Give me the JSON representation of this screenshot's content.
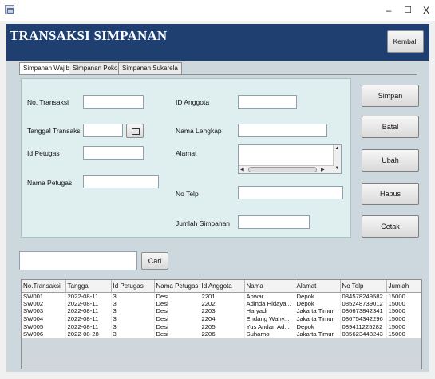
{
  "window": {
    "app_icon": "java-cup-icon",
    "minimize_glyph": "–",
    "maximize_glyph": "☐",
    "close_glyph": "X"
  },
  "header": {
    "title": "TRANSAKSI SIMPANAN",
    "back_label": "Kembali",
    "background_color": "#1f3f71"
  },
  "tabs": [
    {
      "label": "Simpanan Wajib",
      "active": true
    },
    {
      "label": "Simpanan Pokok",
      "active": false
    },
    {
      "label": "Simpanan Sukarela",
      "active": false
    }
  ],
  "form": {
    "no_transaksi": {
      "label": "No. Transaksi",
      "value": ""
    },
    "tanggal_transaksi": {
      "label": "Tanggal Transaksi",
      "value": ""
    },
    "id_petugas": {
      "label": "Id Petugas",
      "value": ""
    },
    "nama_petugas": {
      "label": "Nama Petugas",
      "value": ""
    },
    "id_anggota": {
      "label": "ID Anggota",
      "value": ""
    },
    "nama_lengkap": {
      "label": "Nama Lengkap",
      "value": ""
    },
    "alamat": {
      "label": "Alamat",
      "value": ""
    },
    "no_telp": {
      "label": "No Telp",
      "value": ""
    },
    "jumlah_simpanan": {
      "label": "Jumlah Simpanan",
      "value": ""
    }
  },
  "actions": {
    "simpan": "Simpan",
    "batal": "Batal",
    "ubah": "Ubah",
    "hapus": "Hapus",
    "cetak": "Cetak"
  },
  "search": {
    "value": "",
    "button_label": "Cari"
  },
  "table": {
    "columns": [
      "No.Transaksi",
      "Tanggal",
      "Id Petugas",
      "Nama Petugas",
      "Id Anggota",
      "Nama",
      "Alamat",
      "No Telp",
      "Jumlah"
    ],
    "rows": [
      [
        "SW001",
        "2022-08-11",
        "3",
        "Desi",
        "2201",
        "Anwar",
        "Depok",
        "084578249582",
        "15000"
      ],
      [
        "SW002",
        "2022-08-11",
        "3",
        "Desi",
        "2202",
        "Adinda Hidaya...",
        "Depok",
        "085248739012",
        "15000"
      ],
      [
        "SW003",
        "2022-08-11",
        "3",
        "Desi",
        "2203",
        "Haryadi",
        "Jakarta Timur",
        "086673842341",
        "15000"
      ],
      [
        "SW004",
        "2022-08-11",
        "3",
        "Desi",
        "2204",
        "Endang Wahy...",
        "Jakarta Timur",
        "086754342296",
        "15000"
      ],
      [
        "SW005",
        "2022-08-11",
        "3",
        "Desi",
        "2205",
        "Yus Andari Ad...",
        "Depok",
        "089411225282",
        "15000"
      ],
      [
        "SW006",
        "2022-08-28",
        "3",
        "Desi",
        "2206",
        "Suharno",
        "Jakarta Timur",
        "085623448243",
        "15000"
      ]
    ]
  }
}
